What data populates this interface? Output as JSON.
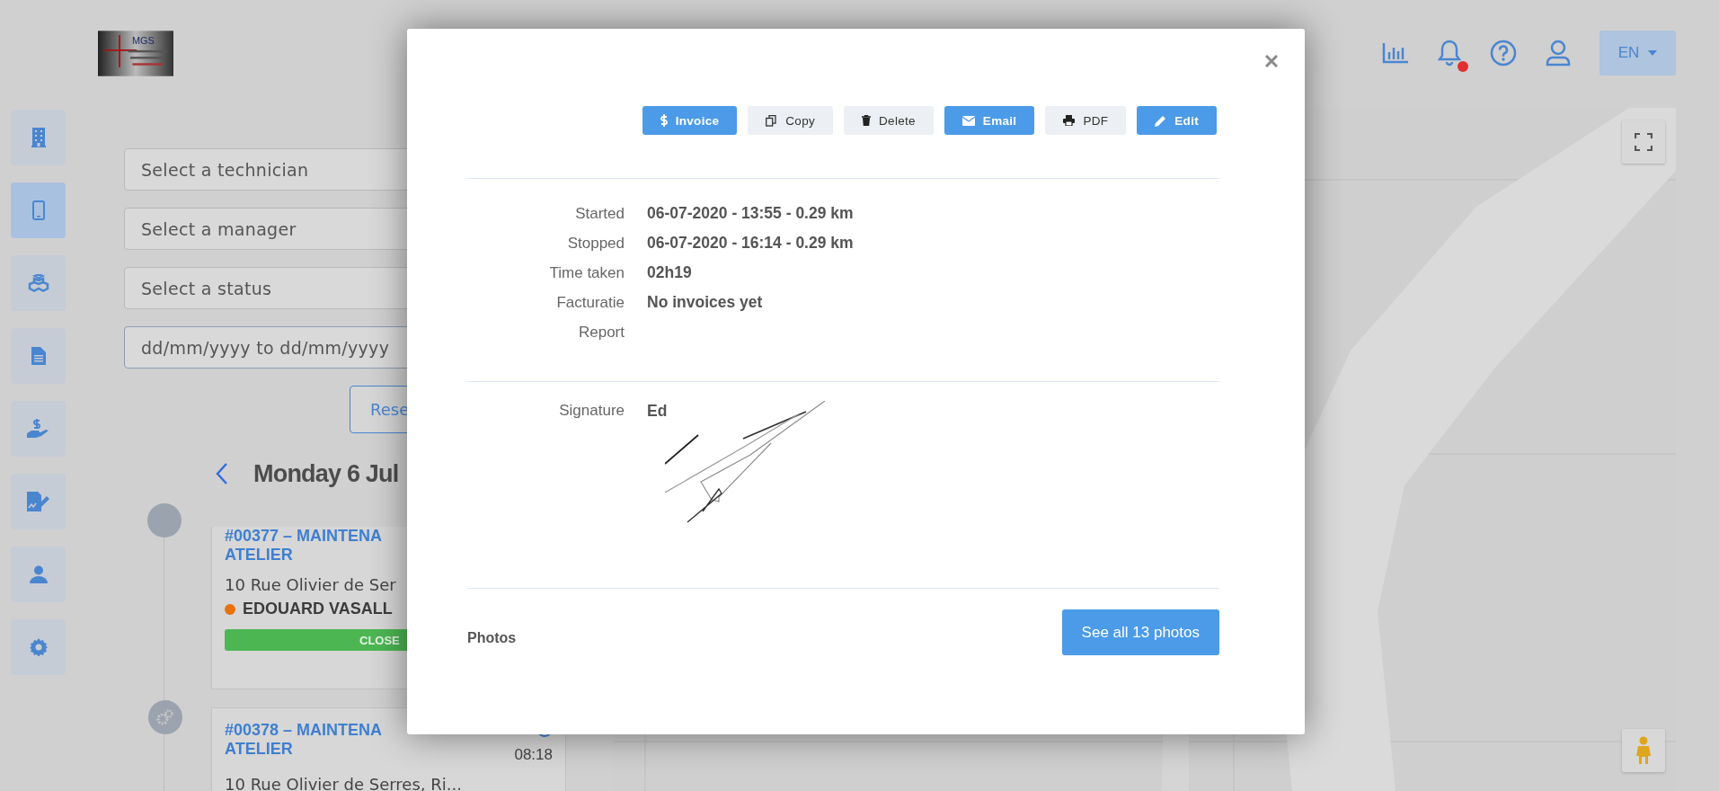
{
  "header": {
    "logo_text": "MGS",
    "language": "EN",
    "notification_dot": true
  },
  "sidebar": {
    "items": [
      {
        "kind": "building",
        "selected": false
      },
      {
        "kind": "mobile",
        "selected": true
      },
      {
        "kind": "boxes",
        "selected": false
      },
      {
        "kind": "document",
        "selected": false
      },
      {
        "kind": "payment",
        "selected": false
      },
      {
        "kind": "signing",
        "selected": false
      },
      {
        "kind": "user",
        "selected": false
      },
      {
        "kind": "settings",
        "selected": false
      }
    ]
  },
  "filters": [
    {
      "placeholder": "Select a technician"
    },
    {
      "placeholder": "Select a manager"
    },
    {
      "placeholder": "Select a status"
    },
    {
      "placeholder": "dd/mm/yyyy to dd/mm/yyyy"
    }
  ],
  "reset_button": "Rese",
  "day_heading": "Monday 6 Jul",
  "jobs": [
    {
      "title": "#00377 – MAINTENA",
      "subtitle": "ATELIER",
      "address": "10 Rue Olivier de Ser",
      "technician": "EDOUARD VASALL",
      "color": "#e8730c",
      "status": "CLOSE"
    },
    {
      "title": "#00378 – MAINTENA",
      "subtitle": "ATELIER",
      "time": "08:18",
      "address": "10 Rue Olivier de Serres, Ri..."
    }
  ],
  "modal": {
    "buttons": [
      {
        "label": "Invoice",
        "kind": "invoice"
      },
      {
        "label": "Copy",
        "kind": "copy"
      },
      {
        "label": "Delete",
        "kind": "delete"
      },
      {
        "label": "Email",
        "kind": "email"
      },
      {
        "label": "PDF",
        "kind": "pdf"
      },
      {
        "label": "Edit",
        "kind": "edit"
      }
    ],
    "details": [
      {
        "label": "Started",
        "value": "06-07-2020 - 13:55 - 0.29 km"
      },
      {
        "label": "Stopped",
        "value": "06-07-2020 - 16:14 - 0.29 km"
      },
      {
        "label": "Time taken",
        "value": "02h19"
      },
      {
        "label": "Facturatie",
        "value": "No invoices yet"
      },
      {
        "label": "Report"
      }
    ],
    "signature": {
      "label": "Signature",
      "name": "Ed"
    },
    "photos": {
      "label": "Photos",
      "button": "See all 13 photos"
    }
  }
}
